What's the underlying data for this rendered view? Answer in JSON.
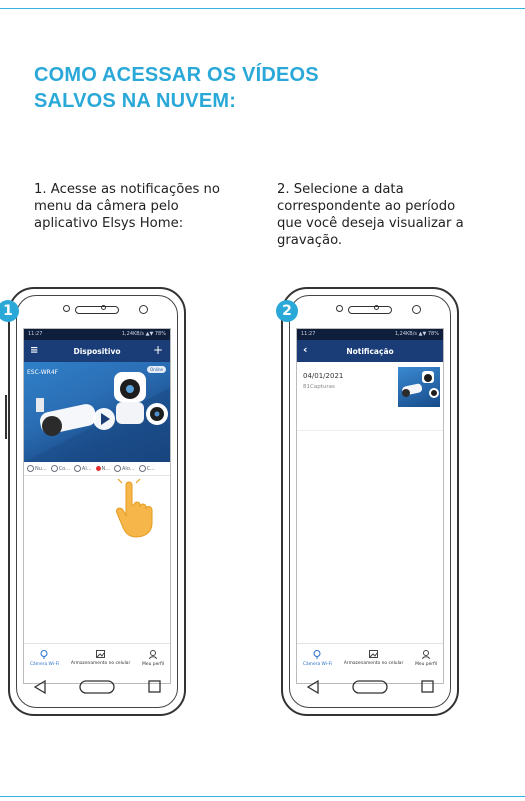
{
  "header": {
    "title_line1": "COMO ACESSAR OS VÍDEOS",
    "title_line2": "SALVOS NA NUVEM:"
  },
  "steps": [
    {
      "number": "1",
      "text": "1. Acesse as notificações no menu da câmera pelo aplicativo Elsys Home:",
      "phone": {
        "status_time": "11:27",
        "status_right": "1,24KB/s  ▲▼  78%",
        "appbar_title": "Dispositivo",
        "device_name": "ESC-WR4F",
        "device_badge": "Online",
        "menu_items": [
          "Nu...",
          "Co...",
          "Al...",
          "N...",
          "Alo...",
          "C..."
        ],
        "nav": [
          "Câmera Wi-Fi",
          "Armazenamento no celular",
          "Meu perfil"
        ]
      }
    },
    {
      "number": "2",
      "text": "2. Selecione a data correspondente ao período que você deseja visualizar a gravação.",
      "phone": {
        "status_time": "11:27",
        "status_right": "1,24KB/s  ▲▼  78%",
        "appbar_title": "Notificação",
        "notif_date": "04/01/2021",
        "notif_count": "81Capturas",
        "nav": [
          "Câmera Wi-Fi",
          "Armazenamento no celular",
          "Meu perfil"
        ]
      }
    }
  ],
  "colors": {
    "accent": "#2aa8d8",
    "appbar": "#1a3d78",
    "statusbar": "#0f1e3a"
  }
}
